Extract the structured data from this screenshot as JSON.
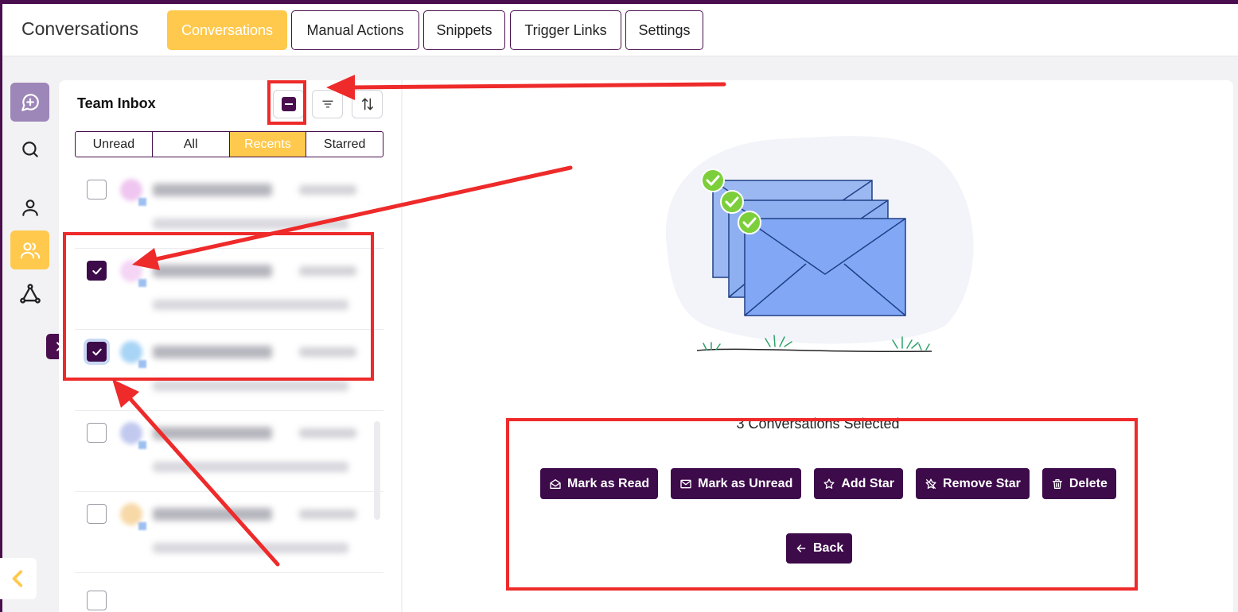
{
  "header": {
    "title": "Conversations",
    "tabs": [
      {
        "label": "Conversations",
        "active": true
      },
      {
        "label": "Manual Actions",
        "active": false
      },
      {
        "label": "Snippets",
        "active": false
      },
      {
        "label": "Trigger Links",
        "active": false
      },
      {
        "label": "Settings",
        "active": false
      }
    ]
  },
  "rail": {
    "icons": [
      "new-chat-icon",
      "search-icon",
      "user-icon",
      "users-icon",
      "network-icon"
    ],
    "active": "users-icon"
  },
  "inbox": {
    "title": "Team Inbox",
    "tools": [
      "select-all-icon",
      "filter-icon",
      "sort-icon"
    ],
    "filter_tabs": [
      {
        "label": "Unread",
        "active": false
      },
      {
        "label": "All",
        "active": false
      },
      {
        "label": "Recents",
        "active": true
      },
      {
        "label": "Starred",
        "active": false
      }
    ],
    "rows": [
      {
        "checked": false
      },
      {
        "checked": true
      },
      {
        "checked": true
      },
      {
        "checked": false
      },
      {
        "checked": false
      }
    ]
  },
  "main": {
    "selected_text": "3 Conversations Selected",
    "actions": [
      {
        "label": "Mark as Read",
        "icon": "envelope-open-icon"
      },
      {
        "label": "Mark as Unread",
        "icon": "envelope-icon"
      },
      {
        "label": "Add Star",
        "icon": "star-icon"
      },
      {
        "label": "Remove Star",
        "icon": "star-off-icon"
      },
      {
        "label": "Delete",
        "icon": "trash-icon"
      }
    ],
    "back_label": "Back"
  },
  "colors": {
    "brand": "#4a0e4e",
    "accent": "#ffc94d",
    "button": "#3d0a4a",
    "annotation": "#ee2a2a"
  }
}
